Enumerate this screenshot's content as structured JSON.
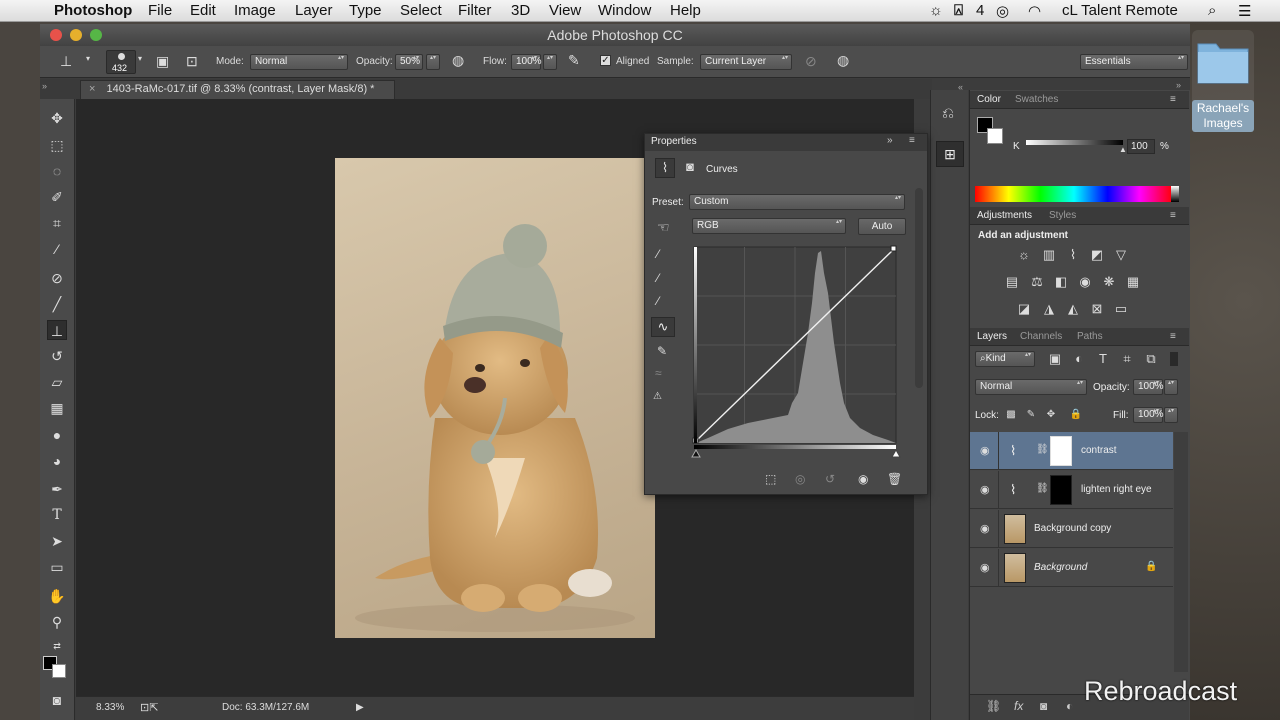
{
  "menubar": {
    "app": "Photoshop",
    "items": [
      "File",
      "Edit",
      "Image",
      "Layer",
      "Type",
      "Select",
      "Filter",
      "3D",
      "View",
      "Window",
      "Help"
    ],
    "status_num": "4",
    "remote_app": "cL Talent Remote"
  },
  "desktop": {
    "folder_label": "Rachael's Images"
  },
  "window": {
    "title": "Adobe Photoshop CC"
  },
  "options_bar": {
    "brush_size": "432",
    "mode_label": "Mode:",
    "mode_value": "Normal",
    "opacity_label": "Opacity:",
    "opacity_value": "50%",
    "flow_label": "Flow:",
    "flow_value": "100%",
    "aligned_label": "Aligned",
    "sample_label": "Sample:",
    "sample_value": "Current Layer",
    "workspace": "Essentials"
  },
  "document": {
    "tab_title": "1403-RaMc-017.tif @ 8.33% (contrast, Layer Mask/8) *"
  },
  "status_bar": {
    "zoom": "8.33%",
    "doc_info": "Doc: 63.3M/127.6M"
  },
  "properties": {
    "title": "Properties",
    "adjustment": "Curves",
    "preset_label": "Preset:",
    "preset_value": "Custom",
    "channel_value": "RGB",
    "auto_label": "Auto"
  },
  "color_panel": {
    "tabs": [
      "Color",
      "Swatches"
    ],
    "channel_label": "K",
    "k_value": "100",
    "percent": "%",
    "k_level": 1.0
  },
  "adjustments_panel": {
    "tabs": [
      "Adjustments",
      "Styles"
    ],
    "heading": "Add an adjustment"
  },
  "layers_panel": {
    "tabs": [
      "Layers",
      "Channels",
      "Paths"
    ],
    "filter": "Kind",
    "blend_mode": "Normal",
    "opacity_label": "Opacity:",
    "opacity_value": "100%",
    "lock_label": "Lock:",
    "fill_label": "Fill:",
    "fill_value": "100%",
    "layers": [
      {
        "name": "contrast",
        "selected": true
      },
      {
        "name": "lighten right eye",
        "selected": false
      },
      {
        "name": "Background copy",
        "selected": false
      },
      {
        "name": "Background",
        "selected": false
      }
    ]
  },
  "watermark": "Rebroadcast",
  "colors": {
    "selection": "#5e7591",
    "panel": "#474747",
    "canvas": "#282828"
  }
}
